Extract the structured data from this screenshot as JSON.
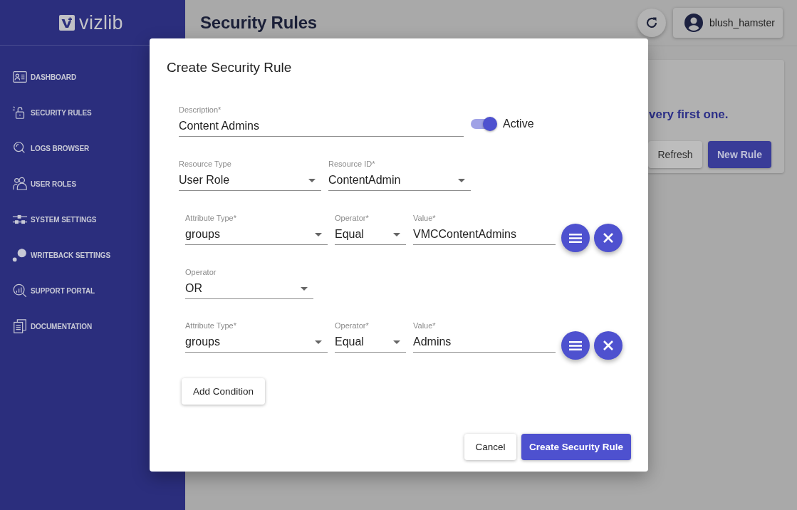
{
  "sidebar": {
    "logo": "vizlib",
    "items": [
      "DASHBOARD",
      "SECURITY RULES",
      "LOGS BROWSER",
      "USER ROLES",
      "SYSTEM SETTINGS",
      "WRITEBACK SETTINGS",
      "SUPPORT PORTAL",
      "DOCUMENTATION"
    ]
  },
  "header": {
    "title": "Security Rules",
    "user": "blush_hamster"
  },
  "empty_state": {
    "message": "very first one.",
    "buttons": [
      {
        "label": "Refresh",
        "kind": "secondary"
      },
      {
        "label": "New Rule",
        "kind": "primary"
      }
    ]
  },
  "dialog": {
    "title": "Create Security Rule",
    "description": {
      "label": "Description*",
      "value": "Content Admins"
    },
    "active": {
      "label": "Active",
      "on": true
    },
    "resource_type": {
      "label": "Resource Type",
      "value": "User Role"
    },
    "resource_id": {
      "label": "Resource ID*",
      "value": "ContentAdmin"
    },
    "rules": [
      {
        "kind": "condition",
        "attribute_type": {
          "label": "Attribute Type*",
          "value": "groups"
        },
        "operator": {
          "label": "Operator*",
          "value": "Equal"
        },
        "value": {
          "label": "Value*",
          "value": "VMCContentAdmins"
        }
      },
      {
        "kind": "join",
        "operator": {
          "label": "Operator",
          "value": "OR"
        }
      },
      {
        "kind": "condition",
        "attribute_type": {
          "label": "Attribute Type*",
          "value": "groups"
        },
        "operator": {
          "label": "Operator*",
          "value": "Equal"
        },
        "value": {
          "label": "Value*",
          "value": "Admins"
        }
      }
    ],
    "add_button": "Add Condition",
    "actions": [
      {
        "label": "Cancel",
        "kind": "secondary"
      },
      {
        "label": "Create Security Rule",
        "kind": "primary"
      }
    ]
  }
}
